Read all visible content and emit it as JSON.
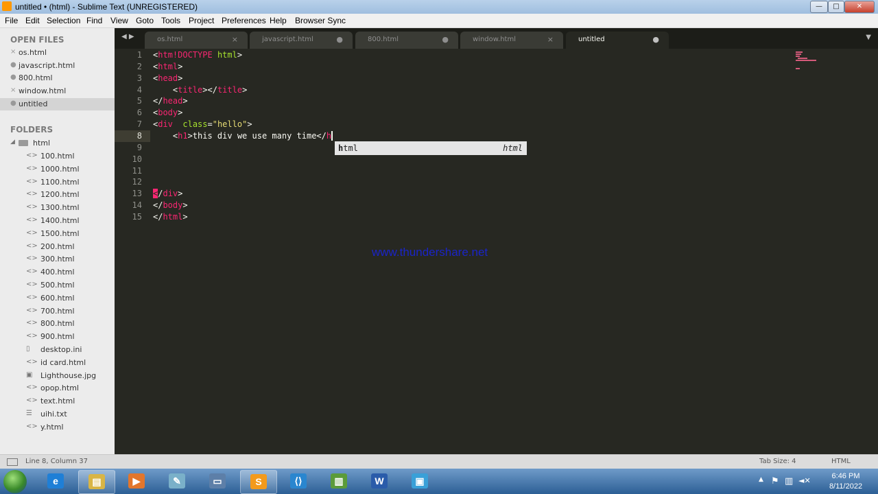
{
  "window": {
    "title": "untitled • (html) - Sublime Text (UNREGISTERED)",
    "controls": {
      "minimize": "—",
      "maximize": "□",
      "close": "✕"
    }
  },
  "menu": [
    "File",
    "Edit",
    "Selection",
    "Find",
    "View",
    "Goto",
    "Tools",
    "Project",
    "Preferences",
    "Help",
    "Browser Sync"
  ],
  "sidebar": {
    "open_files_header": "OPEN FILES",
    "open_files": [
      {
        "name": "os.html",
        "mark": "×"
      },
      {
        "name": "javascript.html",
        "mark": "●"
      },
      {
        "name": "800.html",
        "mark": "●"
      },
      {
        "name": "window.html",
        "mark": "×"
      },
      {
        "name": "untitled",
        "mark": "●"
      }
    ],
    "folders_header": "FOLDERS",
    "folder": {
      "name": "html",
      "expand_mark": "◢"
    },
    "files": [
      {
        "name": "100.html",
        "icon": "<>"
      },
      {
        "name": "1000.html",
        "icon": "<>"
      },
      {
        "name": "1100.html",
        "icon": "<>"
      },
      {
        "name": "1200.html",
        "icon": "<>"
      },
      {
        "name": "1300.html",
        "icon": "<>"
      },
      {
        "name": "1400.html",
        "icon": "<>"
      },
      {
        "name": "1500.html",
        "icon": "<>"
      },
      {
        "name": "200.html",
        "icon": "<>"
      },
      {
        "name": "300.html",
        "icon": "<>"
      },
      {
        "name": "400.html",
        "icon": "<>"
      },
      {
        "name": "500.html",
        "icon": "<>"
      },
      {
        "name": "600.html",
        "icon": "<>"
      },
      {
        "name": "700.html",
        "icon": "<>"
      },
      {
        "name": "800.html",
        "icon": "<>"
      },
      {
        "name": "900.html",
        "icon": "<>"
      },
      {
        "name": "desktop.ini",
        "icon": "▯"
      },
      {
        "name": "id card.html",
        "icon": "<>"
      },
      {
        "name": "Lighthouse.jpg",
        "icon": "▣"
      },
      {
        "name": "opop.html",
        "icon": "<>"
      },
      {
        "name": "text.html",
        "icon": "<>"
      },
      {
        "name": "uihi.txt",
        "icon": "☰"
      },
      {
        "name": "y.html",
        "icon": "<>"
      }
    ]
  },
  "tabs": [
    {
      "label": "os.html",
      "ctl": "×"
    },
    {
      "label": "javascript.html",
      "ctl": "●"
    },
    {
      "label": "800.html",
      "ctl": "●"
    },
    {
      "label": "window.html",
      "ctl": "×"
    },
    {
      "label": "untitled",
      "ctl": "●"
    }
  ],
  "tab_nav": "◀ ▶",
  "tab_dropdown": "▼",
  "editor": {
    "line_numbers": [
      "1",
      "2",
      "3",
      "4",
      "5",
      "6",
      "7",
      "8",
      "9",
      "10",
      "11",
      "12",
      "13",
      "14",
      "15"
    ],
    "current_line": 8,
    "lines": [
      [
        [
          "p",
          "<"
        ],
        [
          "t",
          "htm!DOCTYPE"
        ],
        [
          "p",
          " "
        ],
        [
          "a",
          "html"
        ],
        [
          "p",
          ">"
        ]
      ],
      [
        [
          "p",
          "<"
        ],
        [
          "t",
          "html"
        ],
        [
          "p",
          ">"
        ]
      ],
      [
        [
          "p",
          "<"
        ],
        [
          "t",
          "head"
        ],
        [
          "p",
          ">"
        ]
      ],
      [
        [
          "p",
          "    <"
        ],
        [
          "t",
          "title"
        ],
        [
          "p",
          "></"
        ],
        [
          "t",
          "title"
        ],
        [
          "p",
          ">"
        ]
      ],
      [
        [
          "p",
          "</"
        ],
        [
          "t",
          "head"
        ],
        [
          "p",
          ">"
        ]
      ],
      [
        [
          "p",
          "<"
        ],
        [
          "t",
          "body"
        ],
        [
          "p",
          ">"
        ]
      ],
      [
        [
          "p",
          "<"
        ],
        [
          "t",
          "div"
        ],
        [
          "p",
          "  "
        ],
        [
          "a",
          "class"
        ],
        [
          "p",
          "="
        ],
        [
          "s",
          "\"hello\""
        ],
        [
          "p",
          ">"
        ]
      ],
      [
        [
          "p",
          "    <"
        ],
        [
          "t",
          "h1"
        ],
        [
          "p",
          ">this div we use many time</"
        ],
        [
          "t",
          "h"
        ],
        [
          "c",
          ""
        ]
      ],
      [],
      [],
      [],
      [
        [
          "b",
          "<"
        ],
        [
          "p",
          "/"
        ],
        [
          "t",
          "div"
        ],
        [
          "p",
          ">"
        ]
      ],
      [
        [
          "p",
          "</"
        ],
        [
          "t",
          "body"
        ],
        [
          "p",
          ">"
        ]
      ],
      [
        [
          "p",
          "</"
        ],
        [
          "t",
          "html"
        ],
        [
          "p",
          ">"
        ]
      ]
    ]
  },
  "autocomplete": {
    "match": "h",
    "rest": "tml",
    "hint": "html"
  },
  "watermark": "www.thundershare.net",
  "status": {
    "position": "Line 8, Column 37",
    "tab_size": "Tab Size: 4",
    "syntax": "HTML"
  },
  "taskbar": {
    "apps": [
      {
        "name": "internet-explorer",
        "glyph": "e",
        "color": "#1f7fd6"
      },
      {
        "name": "file-explorer",
        "glyph": "▤",
        "color": "#d9b545"
      },
      {
        "name": "media-player",
        "glyph": "▶",
        "color": "#e2762d"
      },
      {
        "name": "notepad",
        "glyph": "✎",
        "color": "#7ab0c9"
      },
      {
        "name": "remote-desktop",
        "glyph": "▭",
        "color": "#5d7fa8"
      },
      {
        "name": "sublime-text",
        "glyph": "S",
        "color": "#f39a1c"
      },
      {
        "name": "visual-studio-code",
        "glyph": "⟨⟩",
        "color": "#2a86cf"
      },
      {
        "name": "task-manager",
        "glyph": "▥",
        "color": "#5b9b3a"
      },
      {
        "name": "microsoft-word",
        "glyph": "W",
        "color": "#2a5caa"
      },
      {
        "name": "screen-capture",
        "glyph": "▣",
        "color": "#39a0d8"
      }
    ],
    "tray": {
      "arrow": "▲",
      "flag": "⚑",
      "network": "▥",
      "volume": "◄✕"
    },
    "clock_time": "6:46 PM",
    "clock_date": "8/11/2022"
  }
}
